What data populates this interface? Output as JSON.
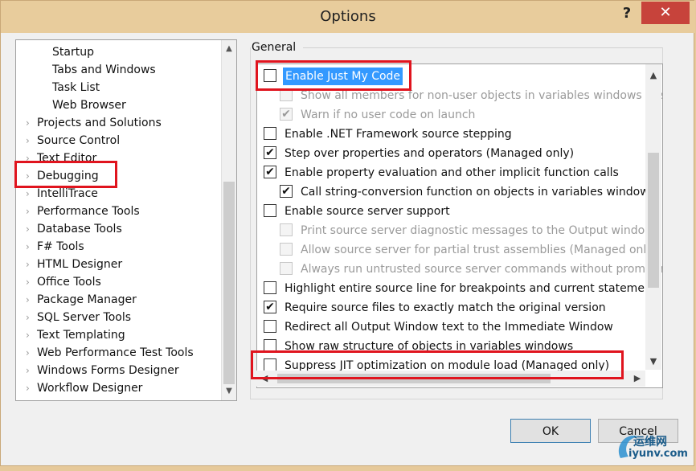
{
  "window": {
    "title": "Options",
    "help_glyph": "?",
    "close_glyph": "✕"
  },
  "tree": {
    "items": [
      {
        "label": "Startup",
        "child": true
      },
      {
        "label": "Tabs and Windows",
        "child": true
      },
      {
        "label": "Task List",
        "child": true
      },
      {
        "label": "Web Browser",
        "child": true
      },
      {
        "label": "Projects and Solutions",
        "child": false
      },
      {
        "label": "Source Control",
        "child": false
      },
      {
        "label": "Text Editor",
        "child": false
      },
      {
        "label": "Debugging",
        "child": false
      },
      {
        "label": "IntelliTrace",
        "child": false
      },
      {
        "label": "Performance Tools",
        "child": false
      },
      {
        "label": "Database Tools",
        "child": false
      },
      {
        "label": "F# Tools",
        "child": false
      },
      {
        "label": "HTML Designer",
        "child": false
      },
      {
        "label": "Office Tools",
        "child": false
      },
      {
        "label": "Package Manager",
        "child": false
      },
      {
        "label": "SQL Server Tools",
        "child": false
      },
      {
        "label": "Text Templating",
        "child": false
      },
      {
        "label": "Web Performance Test Tools",
        "child": false
      },
      {
        "label": "Windows Forms Designer",
        "child": false
      },
      {
        "label": "Workflow Designer",
        "child": false
      }
    ],
    "expander_glyph": "›"
  },
  "general": {
    "group_label": "General",
    "options": [
      {
        "label": "Enable Just My Code",
        "checked": false,
        "enabled": true,
        "indent": 0,
        "selected": true
      },
      {
        "label": "Show all members for non-user objects in variables windows (Vis",
        "checked": false,
        "enabled": false,
        "indent": 1
      },
      {
        "label": "Warn if no user code on launch",
        "checked": true,
        "enabled": false,
        "indent": 1
      },
      {
        "label": "Enable .NET Framework source stepping",
        "checked": false,
        "enabled": true,
        "indent": 0
      },
      {
        "label": "Step over properties and operators (Managed only)",
        "checked": true,
        "enabled": true,
        "indent": 0
      },
      {
        "label": "Enable property evaluation and other implicit function calls",
        "checked": true,
        "enabled": true,
        "indent": 0
      },
      {
        "label": "Call string-conversion function on objects in variables windows",
        "checked": true,
        "enabled": true,
        "indent": 1
      },
      {
        "label": "Enable source server support",
        "checked": false,
        "enabled": true,
        "indent": 0
      },
      {
        "label": "Print source server diagnostic messages to the Output window",
        "checked": false,
        "enabled": false,
        "indent": 1
      },
      {
        "label": "Allow source server for partial trust assemblies (Managed only)",
        "checked": false,
        "enabled": false,
        "indent": 1
      },
      {
        "label": "Always run untrusted source server commands without prompting",
        "checked": false,
        "enabled": false,
        "indent": 1
      },
      {
        "label": "Highlight entire source line for breakpoints and current statement",
        "checked": false,
        "enabled": true,
        "indent": 0
      },
      {
        "label": "Require source files to exactly match the original version",
        "checked": true,
        "enabled": true,
        "indent": 0
      },
      {
        "label": "Redirect all Output Window text to the Immediate Window",
        "checked": false,
        "enabled": true,
        "indent": 0
      },
      {
        "label": "Show raw structure of objects in variables windows",
        "checked": false,
        "enabled": true,
        "indent": 0
      },
      {
        "label": "Suppress JIT optimization on module load (Managed only)",
        "checked": false,
        "enabled": true,
        "indent": 0
      }
    ]
  },
  "buttons": {
    "ok": "OK",
    "cancel": "Cancel"
  },
  "watermark": {
    "line1": "运维网",
    "line2": "iyunv.com"
  },
  "colors": {
    "highlight": "#e0141e",
    "selection": "#3399ff",
    "close": "#c7433b",
    "titlebar": "#e8cc9c"
  }
}
